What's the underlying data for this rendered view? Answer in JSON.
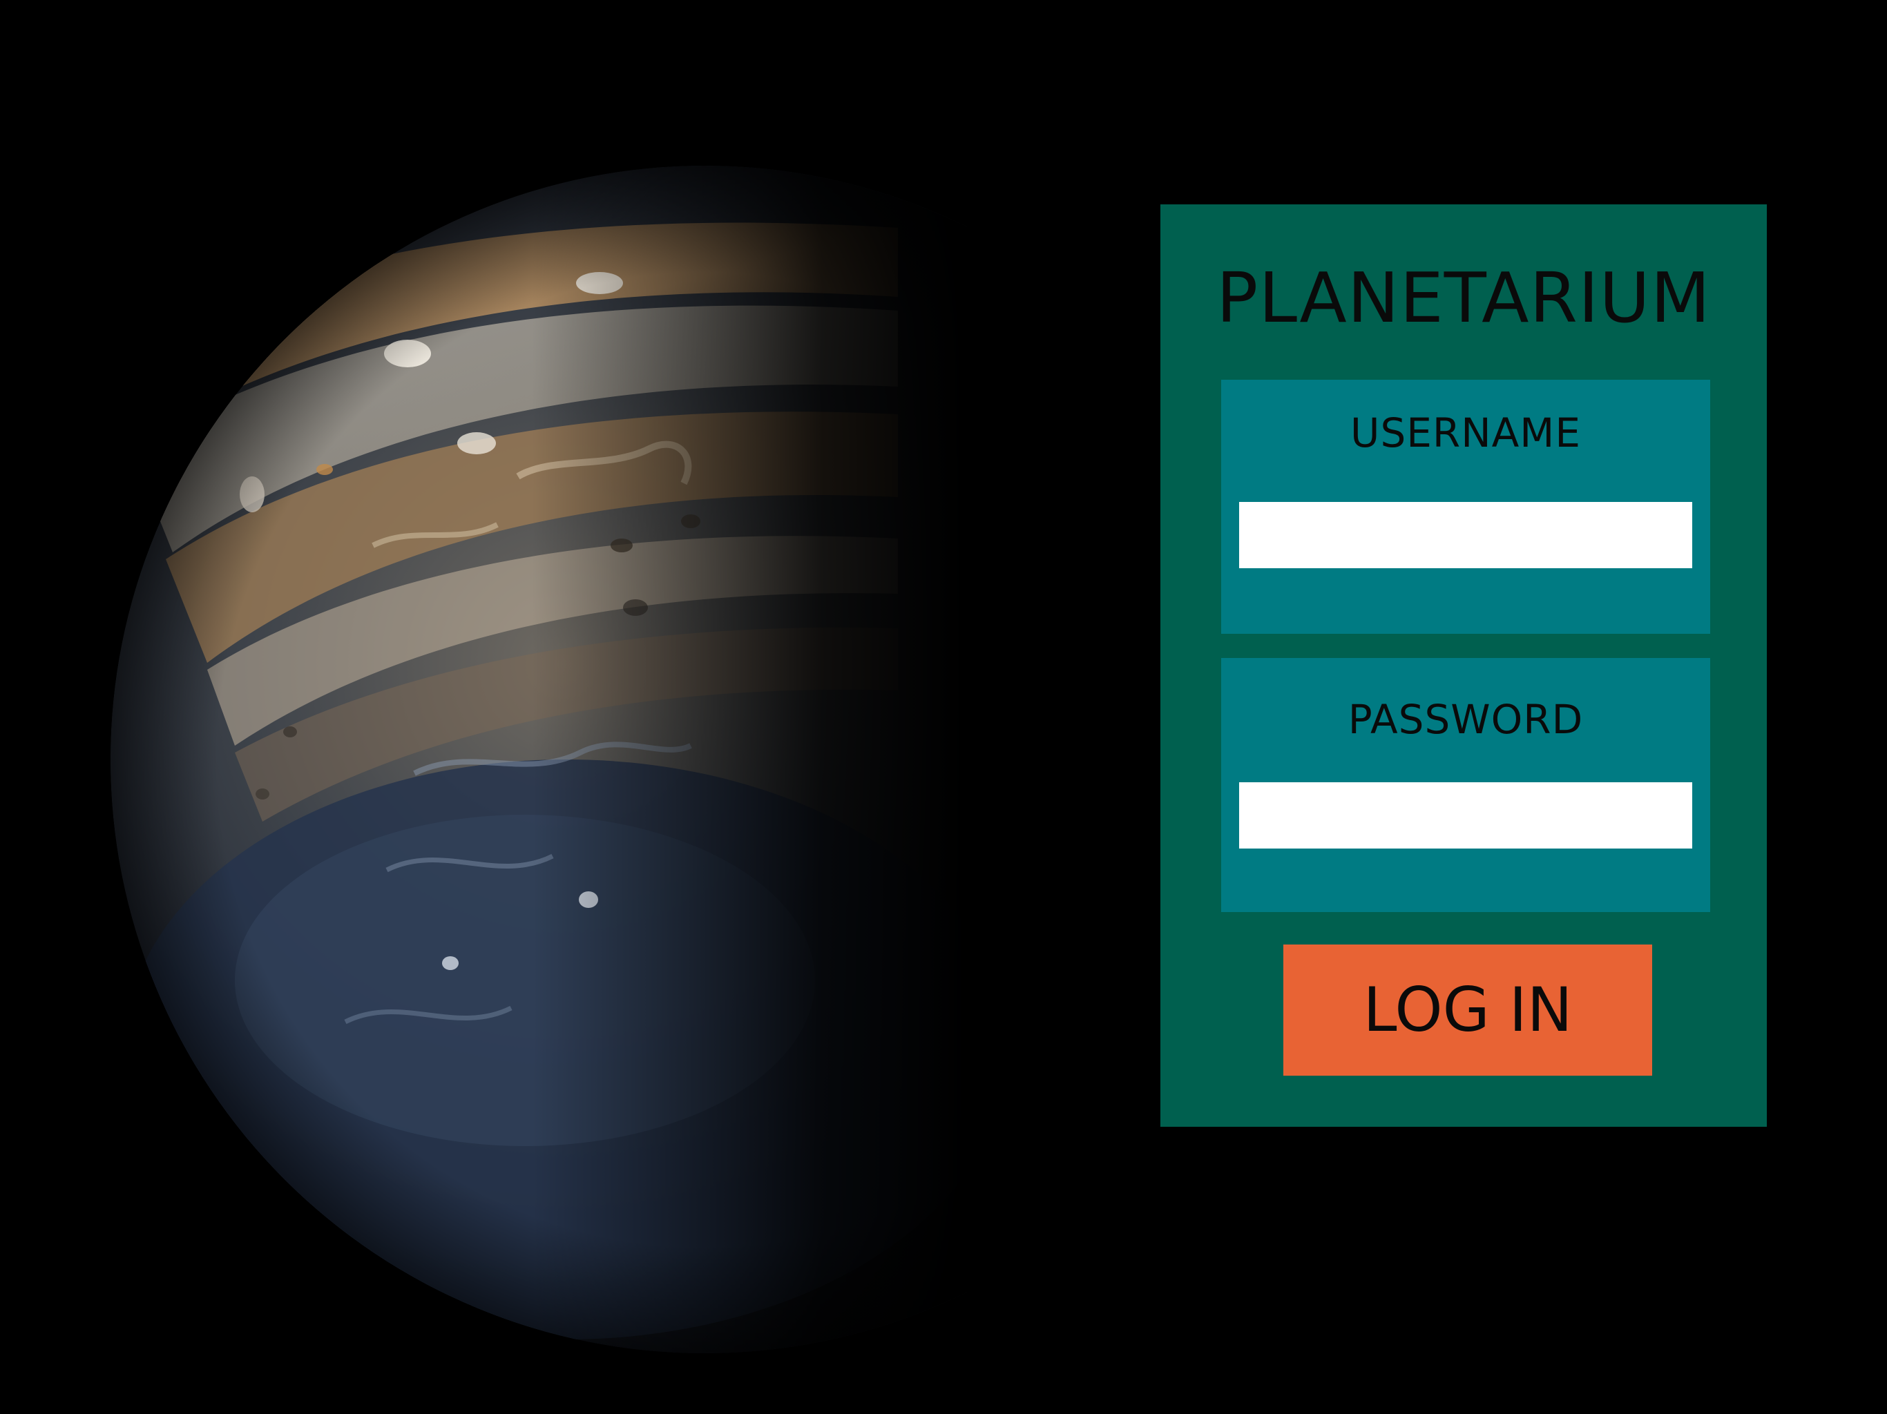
{
  "colors": {
    "background": "#000000",
    "panel": "#00604f",
    "field_box": "#007b83",
    "input_background": "#ffffff",
    "login_button": "#e86334",
    "text": "#0a0a0a"
  },
  "hero": {
    "image": "planet-jupiter-image"
  },
  "login": {
    "title": "PLANETARIUM",
    "username": {
      "label": "USERNAME",
      "value": ""
    },
    "password": {
      "label": "PASSWORD",
      "value": ""
    },
    "submit_label": "LOG IN"
  }
}
